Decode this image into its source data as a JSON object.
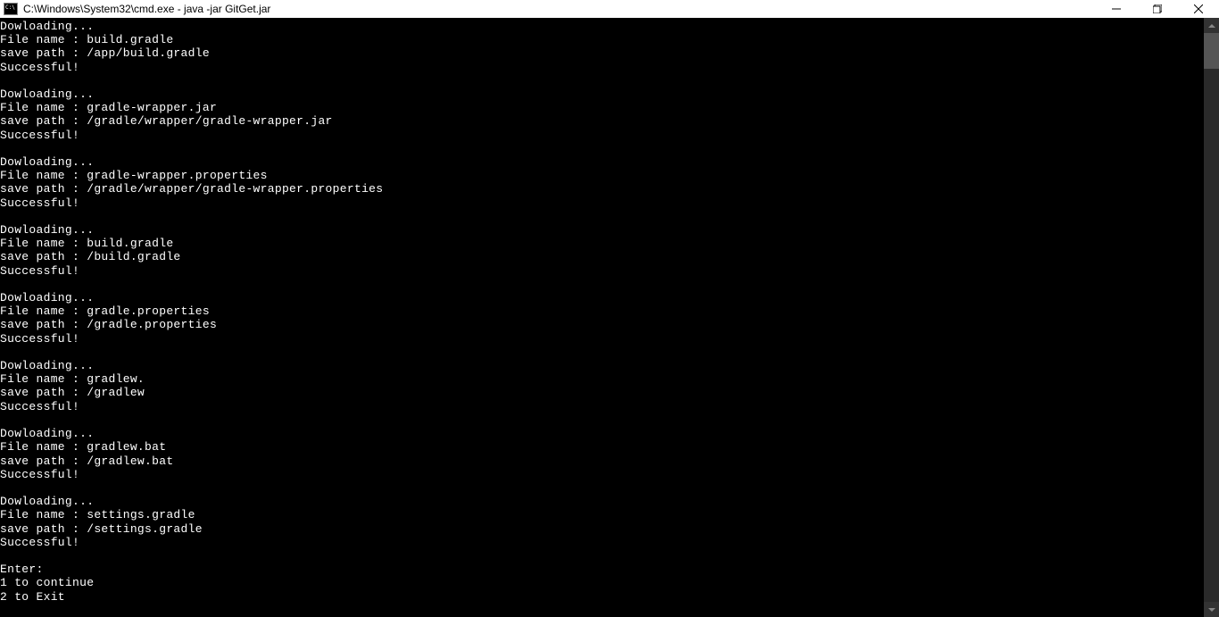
{
  "window": {
    "title": "C:\\Windows\\System32\\cmd.exe - java  -jar GitGet.jar"
  },
  "downloads": [
    {
      "downloading": "Dowloading...",
      "filename_label": "File name : ",
      "filename": "build.gradle",
      "savepath_label": "save path : ",
      "savepath": "/app/build.gradle",
      "status": "Successful!"
    },
    {
      "downloading": "Dowloading...",
      "filename_label": "File name : ",
      "filename": "gradle-wrapper.jar",
      "savepath_label": "save path : ",
      "savepath": "/gradle/wrapper/gradle-wrapper.jar",
      "status": "Successful!"
    },
    {
      "downloading": "Dowloading...",
      "filename_label": "File name : ",
      "filename": "gradle-wrapper.properties",
      "savepath_label": "save path : ",
      "savepath": "/gradle/wrapper/gradle-wrapper.properties",
      "status": "Successful!"
    },
    {
      "downloading": "Dowloading...",
      "filename_label": "File name : ",
      "filename": "build.gradle",
      "savepath_label": "save path : ",
      "savepath": "/build.gradle",
      "status": "Successful!"
    },
    {
      "downloading": "Dowloading...",
      "filename_label": "File name : ",
      "filename": "gradle.properties",
      "savepath_label": "save path : ",
      "savepath": "/gradle.properties",
      "status": "Successful!"
    },
    {
      "downloading": "Dowloading...",
      "filename_label": "File name : ",
      "filename": "gradlew.",
      "savepath_label": "save path : ",
      "savepath": "/gradlew",
      "status": "Successful!"
    },
    {
      "downloading": "Dowloading...",
      "filename_label": "File name : ",
      "filename": "gradlew.bat",
      "savepath_label": "save path : ",
      "savepath": "/gradlew.bat",
      "status": "Successful!"
    },
    {
      "downloading": "Dowloading...",
      "filename_label": "File name : ",
      "filename": "settings.gradle",
      "savepath_label": "save path : ",
      "savepath": "/settings.gradle",
      "status": "Successful!"
    }
  ],
  "prompt": {
    "enter": "Enter:",
    "option1": "1 to continue",
    "option2": "2 to Exit"
  }
}
